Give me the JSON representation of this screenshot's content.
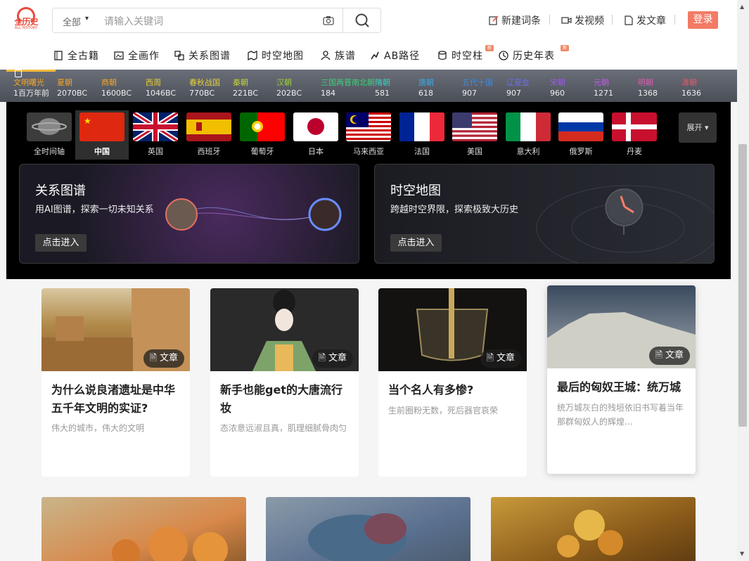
{
  "header": {
    "logo_text": "全历史",
    "logo_sub": "ALL HISTORY",
    "search": {
      "category": "全部",
      "placeholder": "请输入关键词"
    },
    "links": [
      "新建词条",
      "发视频",
      "发文章"
    ],
    "login": "登录"
  },
  "nav": [
    {
      "label": "全古籍",
      "icon": "book-icon",
      "badge": ""
    },
    {
      "label": "全画作",
      "icon": "painting-icon",
      "badge": ""
    },
    {
      "label": "关系图谱",
      "icon": "graph-icon",
      "badge": ""
    },
    {
      "label": "时空地图",
      "icon": "map-icon",
      "badge": ""
    },
    {
      "label": "族谱",
      "icon": "person-icon",
      "badge": ""
    },
    {
      "label": "AB路径",
      "icon": "path-icon",
      "badge": ""
    },
    {
      "label": "时空柱",
      "icon": "database-icon",
      "badge": "新"
    },
    {
      "label": "历史年表",
      "icon": "clock-icon",
      "badge": "新"
    }
  ],
  "timeline": [
    {
      "era": "文明曙光",
      "year": "1百万年前",
      "color": "#f5a623"
    },
    {
      "era": "夏朝",
      "year": "2070BC",
      "color": "#f5a623"
    },
    {
      "era": "商朝",
      "year": "1600BC",
      "color": "#f5a623"
    },
    {
      "era": "西周",
      "year": "1046BC",
      "color": "#e6d23a"
    },
    {
      "era": "春秋战国",
      "year": "770BC",
      "color": "#e6d23a"
    },
    {
      "era": "秦朝",
      "year": "221BC",
      "color": "#c6d33a"
    },
    {
      "era": "汉朝",
      "year": "202BC",
      "color": "#9ed13a"
    },
    {
      "era": "三国两晋南北朝",
      "year": "184",
      "color": "#3ad17a"
    },
    {
      "era": "隋朝",
      "year": "581",
      "color": "#3ad1c0"
    },
    {
      "era": "唐朝",
      "year": "618",
      "color": "#3aa8e6"
    },
    {
      "era": "五代十国",
      "year": "907",
      "color": "#3a8ee6"
    },
    {
      "era": "辽夏金",
      "year": "907",
      "color": "#6a6ee6"
    },
    {
      "era": "宋朝",
      "year": "960",
      "color": "#9a5ae6"
    },
    {
      "era": "元朝",
      "year": "1271",
      "color": "#c05ae6"
    },
    {
      "era": "明朝",
      "year": "1368",
      "color": "#e05ab0"
    },
    {
      "era": "清朝",
      "year": "1636",
      "color": "#e65a6e"
    }
  ],
  "countries": [
    "全时间轴",
    "中国",
    "英国",
    "西班牙",
    "葡萄牙",
    "日本",
    "马来西亚",
    "法国",
    "美国",
    "意大利",
    "俄罗斯",
    "丹麦"
  ],
  "expand": "展开",
  "feature_cards": [
    {
      "title": "关系图谱",
      "desc": "用AI图谱，探索一切未知关系",
      "button": "点击进入"
    },
    {
      "title": "时空地图",
      "desc": "跨越时空界限，探索极致大历史",
      "button": "点击进入"
    }
  ],
  "tag_label": "文章",
  "articles": [
    {
      "title": "为什么说良渚遗址是中华五千年文明的实证?",
      "desc": "伟大的城市，伟大的文明"
    },
    {
      "title": "新手也能get的大唐流行妆",
      "desc": "态浓意远淑且真，肌理细腻骨肉匀"
    },
    {
      "title": "当个名人有多惨?",
      "desc": "生前圈粉无数，死后器官哀荣"
    },
    {
      "title": "最后的匈奴王城：统万城",
      "desc": "统万城灰白的残垣依旧书写着当年那群匈奴人的辉煌..."
    }
  ]
}
